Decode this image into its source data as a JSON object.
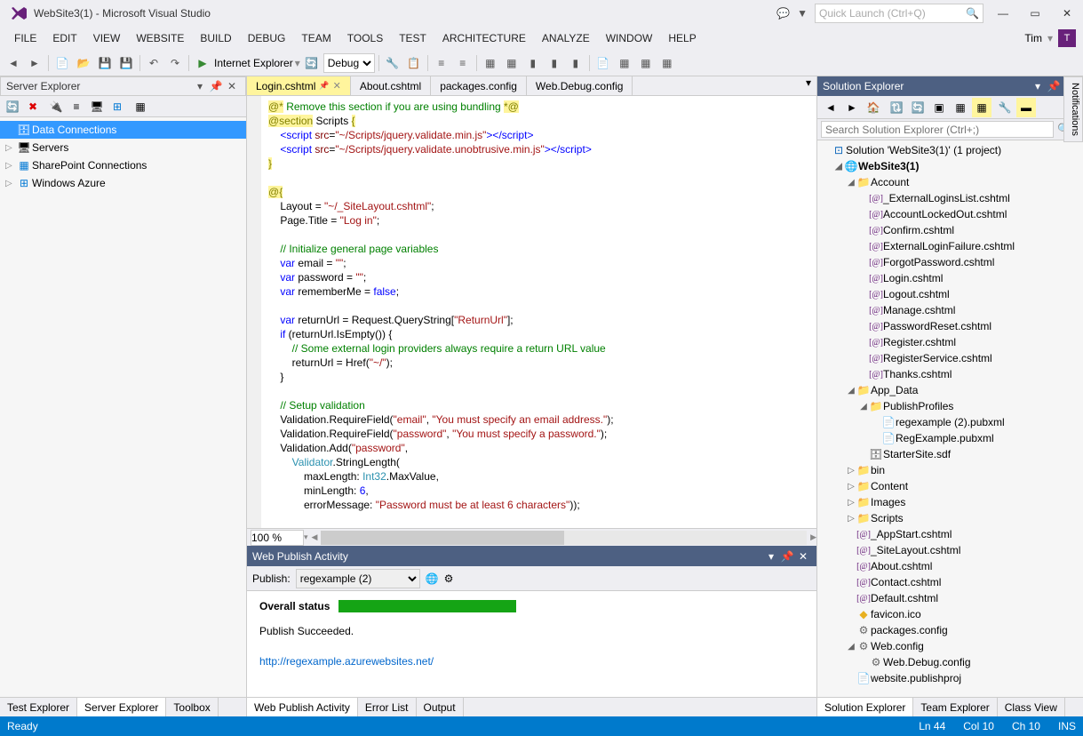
{
  "title": "WebSite3(1) - Microsoft Visual Studio",
  "quick_launch": "Quick Launch (Ctrl+Q)",
  "user": "Tim",
  "user_initial": "T",
  "menu": [
    "FILE",
    "EDIT",
    "VIEW",
    "WEBSITE",
    "BUILD",
    "DEBUG",
    "TEAM",
    "TOOLS",
    "TEST",
    "ARCHITECTURE",
    "ANALYZE",
    "WINDOW",
    "HELP"
  ],
  "toolbar": {
    "browser": "Internet Explorer",
    "config": "Debug"
  },
  "server_explorer": {
    "title": "Server Explorer",
    "items": [
      {
        "label": "Data Connections",
        "icon": "db",
        "selected": true
      },
      {
        "label": "Servers",
        "icon": "server",
        "exp": "▷"
      },
      {
        "label": "SharePoint Connections",
        "icon": "sp",
        "exp": "▷"
      },
      {
        "label": "Windows Azure",
        "icon": "azure",
        "exp": "▷"
      }
    ]
  },
  "editor": {
    "tabs": [
      {
        "label": "Login.cshtml",
        "active": true,
        "pinned": true
      },
      {
        "label": "About.cshtml"
      },
      {
        "label": "packages.config"
      },
      {
        "label": "Web.Debug.config"
      }
    ],
    "zoom": "100 %"
  },
  "publish": {
    "title": "Web Publish Activity",
    "label": "Publish:",
    "profile": "regexample (2)",
    "status_label": "Overall status",
    "message": "Publish Succeeded.",
    "link": "http://regexample.azurewebsites.net/",
    "tabs": [
      "Web Publish Activity",
      "Error List",
      "Output"
    ]
  },
  "solution_explorer": {
    "title": "Solution Explorer",
    "search": "Search Solution Explorer (Ctrl+;)",
    "solution": "Solution 'WebSite3(1)' (1 project)",
    "project": "WebSite3(1)",
    "account_folder": "Account",
    "account_files": [
      "_ExternalLoginsList.cshtml",
      "AccountLockedOut.cshtml",
      "Confirm.cshtml",
      "ExternalLoginFailure.cshtml",
      "ForgotPassword.cshtml",
      "Login.cshtml",
      "Logout.cshtml",
      "Manage.cshtml",
      "PasswordReset.cshtml",
      "Register.cshtml",
      "RegisterService.cshtml",
      "Thanks.cshtml"
    ],
    "appdata_folder": "App_Data",
    "publish_profiles": "PublishProfiles",
    "profile_files": [
      "regexample (2).pubxml",
      "RegExample.pubxml"
    ],
    "starter_site": "StarterSite.sdf",
    "collapsed_folders": [
      "bin",
      "Content",
      "Images",
      "Scripts"
    ],
    "root_files": [
      "_AppStart.cshtml",
      "_SiteLayout.cshtml",
      "About.cshtml",
      "Contact.cshtml",
      "Default.cshtml"
    ],
    "favicon": "favicon.ico",
    "packages": "packages.config",
    "webconfig": "Web.config",
    "webdebug": "Web.Debug.config",
    "publishproj": "website.publishproj",
    "tabs": [
      "Solution Explorer",
      "Team Explorer",
      "Class View"
    ]
  },
  "left_tabs": [
    "Test Explorer",
    "Server Explorer",
    "Toolbox"
  ],
  "status": {
    "ready": "Ready",
    "ln": "Ln 44",
    "col": "Col 10",
    "ch": "Ch 10",
    "ins": "INS"
  },
  "notifications": "Notifications"
}
